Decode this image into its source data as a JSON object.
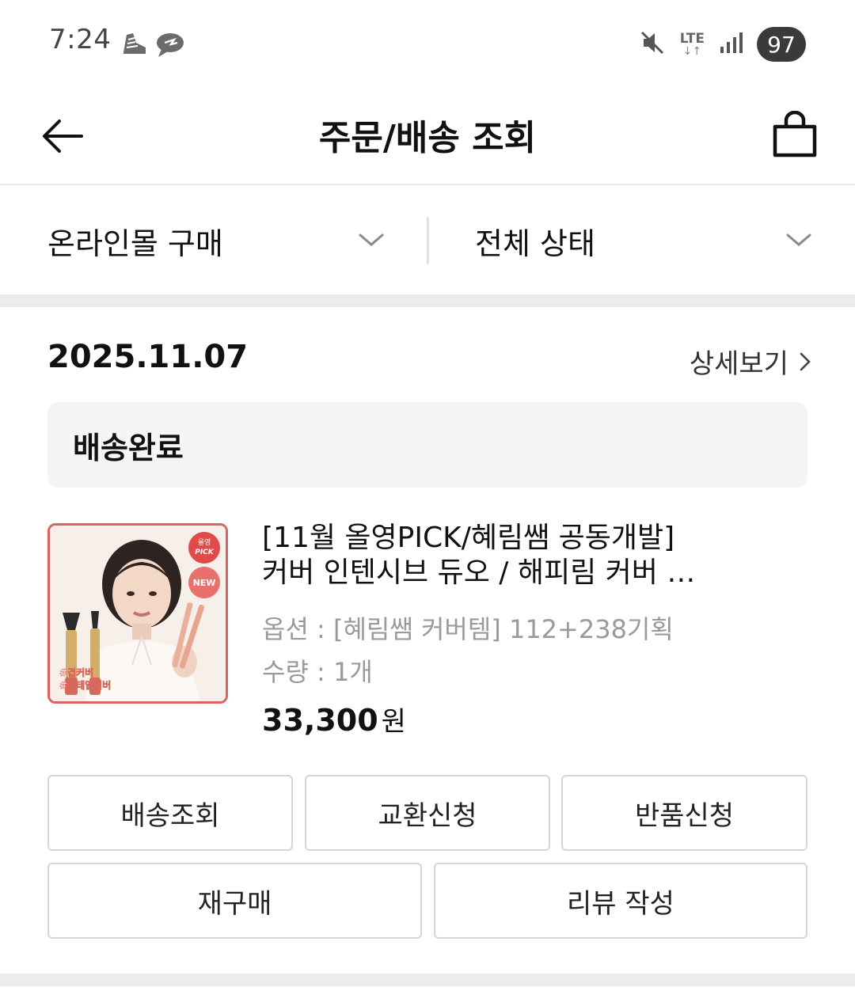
{
  "status_bar": {
    "time": "7:24",
    "network": "LTE",
    "network_arrows": "↓↑",
    "battery": "97",
    "icons": [
      "sneaker-icon",
      "chat-bubble-icon",
      "mute-icon",
      "lte-icon",
      "signal-icon",
      "battery-icon"
    ]
  },
  "header": {
    "title": "주문/배송 조회",
    "back_icon": "back-arrow-icon",
    "cart_icon": "shopping-bag-icon"
  },
  "filters": {
    "channel": "온라인몰 구매",
    "status": "전체 상태"
  },
  "order": {
    "date": "2025.11.07",
    "detail_link": "상세보기",
    "delivery_status": "배송완료",
    "product": {
      "image_badges": [
        "올영",
        "PICK",
        "NEW"
      ],
      "image_tags": [
        "#겹커버",
        "#디테일커버"
      ],
      "name_line1": "[11월 올영PICK/혜림쌤 공동개발]",
      "name_line2": "커버 인텐시브 듀오 / 해피림 커버 …",
      "option": "옵션 : [혜림쌤 커버템] 112+238기획",
      "quantity": "수량 : 1개",
      "price": "33,300",
      "price_unit": "원"
    },
    "actions": {
      "track": "배송조회",
      "exchange": "교환신청",
      "return": "반품신청",
      "reorder": "재구매",
      "review": "리뷰 작성"
    }
  },
  "colors": {
    "accent_red": "#d86462",
    "status_box_bg": "#f4f5f7",
    "section_gap": "#ececec",
    "muted_text": "#9a9a9a"
  }
}
